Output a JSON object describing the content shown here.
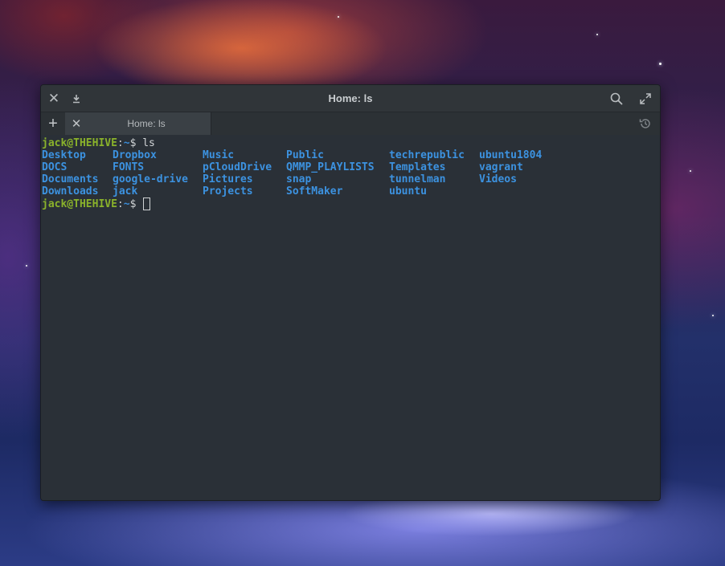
{
  "window": {
    "title": "Home: ls",
    "icons": {
      "close": "close-icon",
      "download": "download-icon",
      "search": "search-icon",
      "maximize": "maximize-icon"
    }
  },
  "tabs": [
    {
      "label": "Home: ls"
    }
  ],
  "tabbar": {
    "new_tab": "+",
    "history_icon": "history-icon"
  },
  "terminal": {
    "prompt_user": "jack@THEHIVE",
    "prompt_sep": ":",
    "prompt_path": "~",
    "prompt_symbol": "$ ",
    "command": "ls",
    "columns": [
      [
        "Desktop",
        "DOCS",
        "Documents",
        "Downloads"
      ],
      [
        "Dropbox",
        "FONTS",
        "google-drive",
        "jack"
      ],
      [
        "Music",
        "pCloudDrive",
        "Pictures",
        "Projects"
      ],
      [
        "Public",
        "QMMP_PLAYLISTS",
        "snap",
        "SoftMaker"
      ],
      [
        "techrepublic",
        "Templates",
        "tunnelman",
        "ubuntu"
      ],
      [
        "ubuntu1804",
        "vagrant",
        "Videos"
      ]
    ]
  },
  "colors": {
    "user": "#8ab22b",
    "directory": "#3c92e0",
    "background": "#2a3037"
  }
}
